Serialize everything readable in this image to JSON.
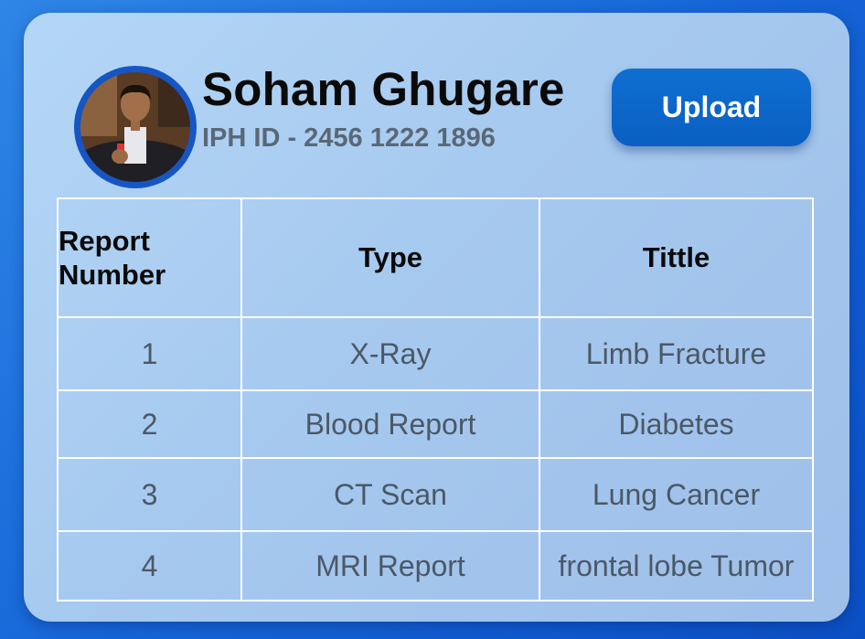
{
  "profile": {
    "name": "Soham Ghugare",
    "id_text": "IPH ID - 2456 1222 1896",
    "avatar_icon": "profile-photo-icon"
  },
  "actions": {
    "upload_label": "Upload"
  },
  "table": {
    "headers": {
      "number_line1": "Report",
      "number_line2": "Number",
      "type": "Type",
      "title": "Tittle"
    },
    "rows": [
      {
        "number": "1",
        "type": "X-Ray",
        "title": "Limb Fracture"
      },
      {
        "number": "2",
        "type": "Blood Report",
        "title": "Diabetes"
      },
      {
        "number": "3",
        "type": "CT Scan",
        "title": "Lung Cancer"
      },
      {
        "number": "4",
        "type": "MRI Report",
        "title": "frontal lobe Tumor"
      }
    ]
  },
  "colors": {
    "background": "#1565d8",
    "card": "#a6c9ef",
    "button": "#0a65c8",
    "avatar_ring": "#1656c4"
  }
}
